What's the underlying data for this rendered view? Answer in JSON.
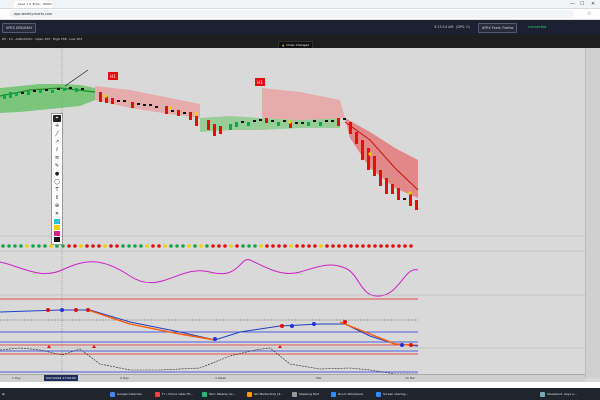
{
  "browser": {
    "tab_title": "Apex 1.0 Tools – Watch…",
    "url": "app.weeklycharts.com",
    "minimize": "—",
    "maximize": "☐",
    "close": "✕"
  },
  "header": {
    "strategy_button": "APEX DREAMAY",
    "time": "3:13:14 AM",
    "fps": "(DPS: 0)",
    "feed_button": "APEX Feed: Firefox",
    "connection": "Connected"
  },
  "chart_header": {
    "symbol_line": "Z3 · 1h · AAPL/OHLC · Open 155 · High 158 · Low 153",
    "alert_badge": "Order Changed",
    "price_tag_1": "H1",
    "price_tag_2": "H1"
  },
  "time_axis": {
    "current_time": "04/7/2024 17:00:03",
    "labels": [
      "1 Day",
      "2 Day",
      "3 Week",
      "Mar",
      "10 Mar"
    ]
  },
  "colors": {
    "bull": "#16a34a",
    "bear": "#e01010",
    "channel_green": "#5cbf5c",
    "channel_red": "#e57373",
    "oscillator": "#d020c8",
    "macd_line": "#ff5a00",
    "signal_line": "#2040c0",
    "level_red": "#e02020",
    "level_blue": "#2030e0"
  },
  "taskbar": {
    "items": [
      "Google Calendar",
      "Fl • Home rates Th…",
      "Taxi: Weekly Lis…",
      "GD Media Prop (2…",
      "Skipping Text",
      "Zoom Workplace",
      "Screen sharing…",
      "Cleveland: Cays a…"
    ]
  }
}
